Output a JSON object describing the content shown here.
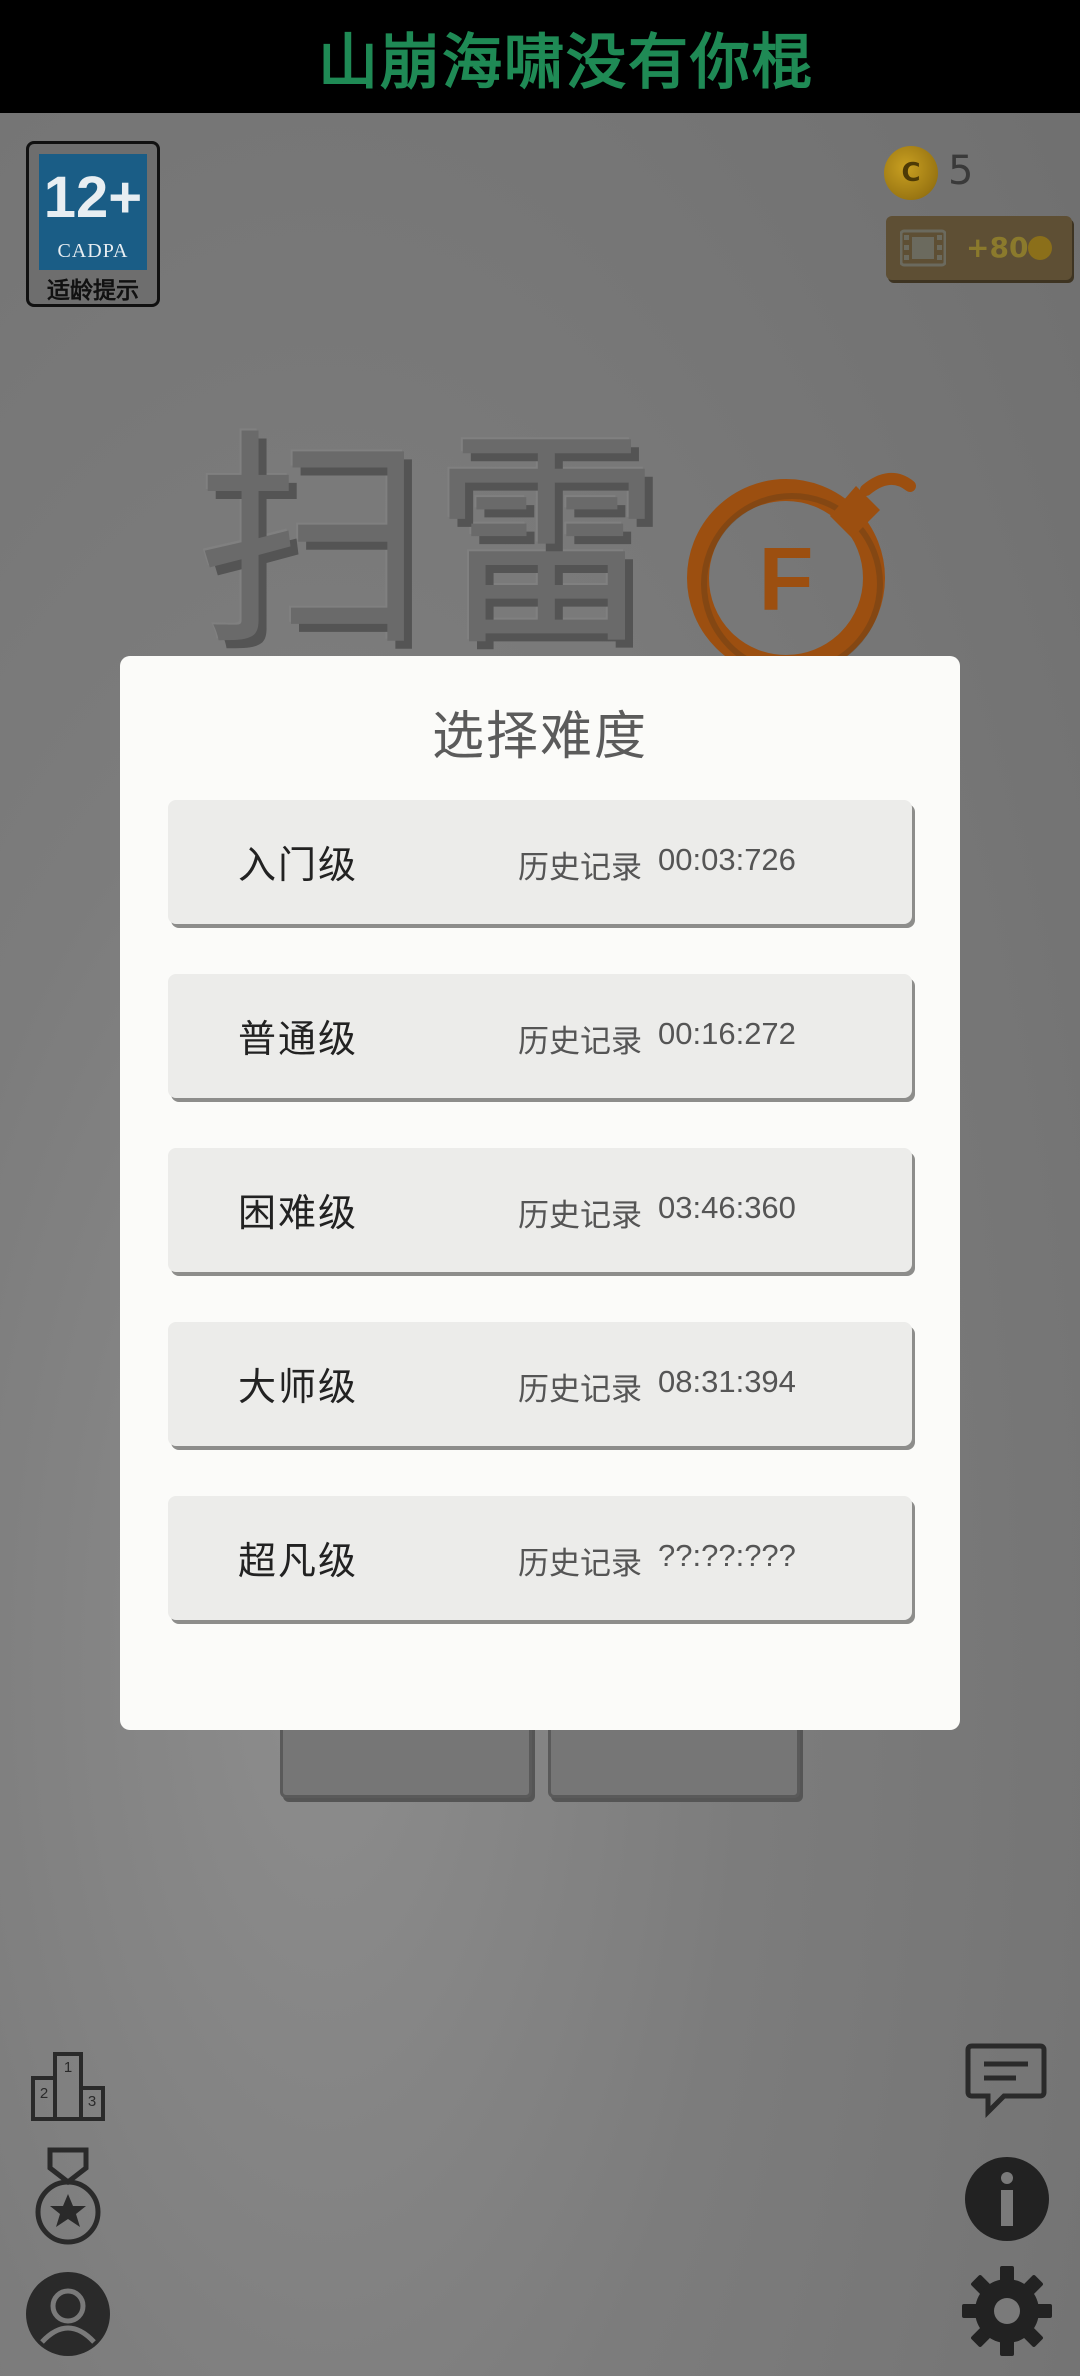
{
  "banner": {
    "text": "山崩海啸没有你棍"
  },
  "age_badge": {
    "rating": "12+",
    "org": "CADPA",
    "caption": "适龄提示"
  },
  "coins": {
    "icon_letter": "C",
    "count": "5"
  },
  "video_reward": {
    "label": "+80"
  },
  "logo": {
    "text": "扫雷",
    "bomb_letter": "F"
  },
  "modal": {
    "title": "选择难度",
    "levels": [
      {
        "name": "入门级",
        "history_label": "历史记录",
        "time": "00:03:726"
      },
      {
        "name": "普通级",
        "history_label": "历史记录",
        "time": "00:16:272"
      },
      {
        "name": "困难级",
        "history_label": "历史记录",
        "time": "03:46:360"
      },
      {
        "name": "大师级",
        "history_label": "历史记录",
        "time": "08:31:394"
      },
      {
        "name": "超凡级",
        "history_label": "历史记录",
        "time": "??:??:???"
      }
    ]
  },
  "icons": {
    "rank": "leaderboard-icon",
    "medal": "medal-icon",
    "profile": "profile-icon",
    "chat": "feedback-chat-icon",
    "info": "info-icon",
    "settings": "gear-icon"
  },
  "colors": {
    "banner_text": "#1f8a55",
    "bomb": "#b45a12",
    "modal_bg": "#fbfbf9",
    "row_bg": "#ececea"
  }
}
